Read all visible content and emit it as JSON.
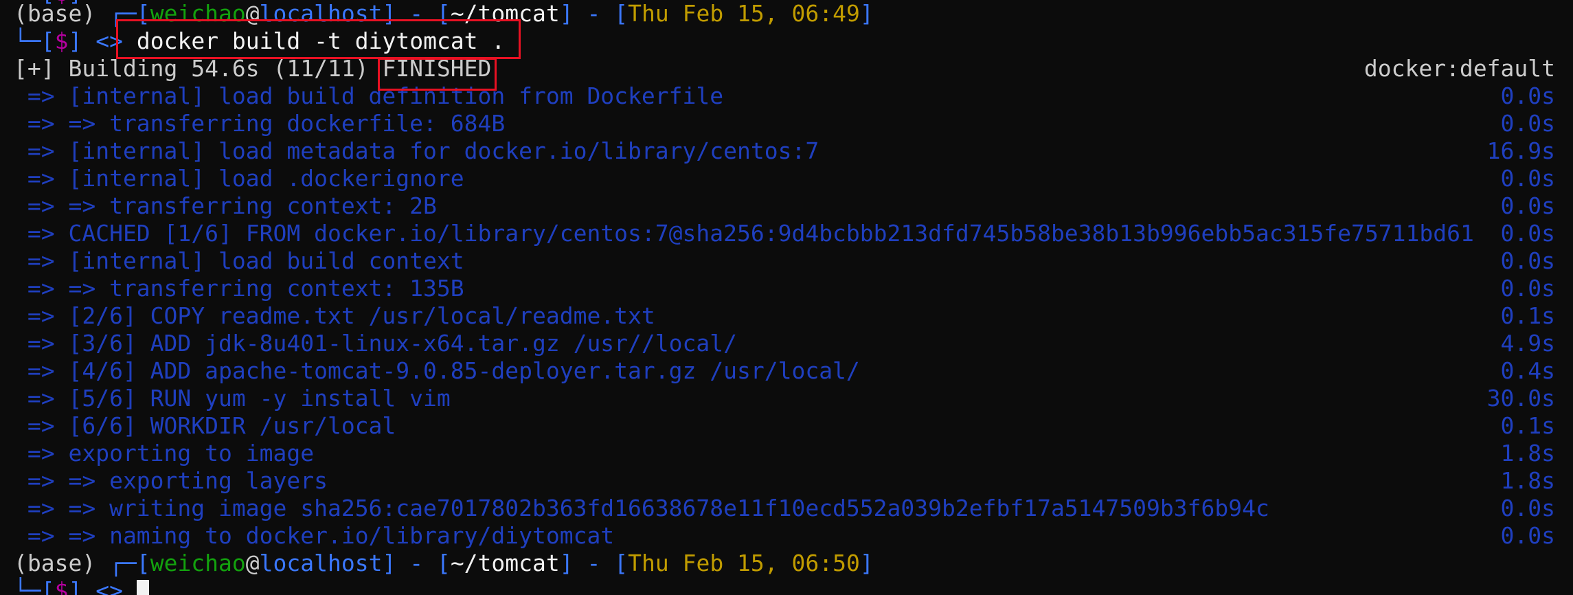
{
  "prompt1": {
    "env": "(base)",
    "corner": "┌─[",
    "user": "weichao",
    "at": "@",
    "host": "localhost",
    "sep1": "] - [",
    "dir": "~/tomcat",
    "sep2": "] - [",
    "time": "Thu Feb 15, 06:49",
    "close": "]",
    "line2_prefix": "└─[",
    "dollar": "$",
    "line2_close": "]",
    "arrow": "<>",
    "command": "docker build -t diytomcat ."
  },
  "build_header": {
    "prefix": "[+] Building 54.6s (11/11) ",
    "status": "FINISHED",
    "context": "docker:default"
  },
  "steps": [
    {
      "text": " => [internal] load build definition from Dockerfile",
      "time": "0.0s"
    },
    {
      "text": " => => transferring dockerfile: 684B",
      "time": "0.0s"
    },
    {
      "text": " => [internal] load metadata for docker.io/library/centos:7",
      "time": "16.9s"
    },
    {
      "text": " => [internal] load .dockerignore",
      "time": "0.0s"
    },
    {
      "text": " => => transferring context: 2B",
      "time": "0.0s"
    },
    {
      "text": " => CACHED [1/6] FROM docker.io/library/centos:7@sha256:9d4bcbbb213dfd745b58be38b13b996ebb5ac315fe75711bd61",
      "time": "0.0s"
    },
    {
      "text": " => [internal] load build context",
      "time": "0.0s"
    },
    {
      "text": " => => transferring context: 135B",
      "time": "0.0s"
    },
    {
      "text": " => [2/6] COPY readme.txt /usr/local/readme.txt",
      "time": "0.1s"
    },
    {
      "text": " => [3/6] ADD jdk-8u401-linux-x64.tar.gz /usr//local/",
      "time": "4.9s"
    },
    {
      "text": " => [4/6] ADD apache-tomcat-9.0.85-deployer.tar.gz /usr/local/",
      "time": "0.4s"
    },
    {
      "text": " => [5/6] RUN yum -y install vim",
      "time": "30.0s"
    },
    {
      "text": " => [6/6] WORKDIR /usr/local",
      "time": "0.1s"
    },
    {
      "text": " => exporting to image",
      "time": "1.8s"
    },
    {
      "text": " => => exporting layers",
      "time": "1.8s"
    },
    {
      "text": " => => writing image sha256:cae7017802b363fd16638678e11f10ecd552a039b2efbf17a5147509b3f6b94c",
      "time": "0.0s"
    },
    {
      "text": " => => naming to docker.io/library/diytomcat",
      "time": "0.0s"
    }
  ],
  "prompt2": {
    "env": "(base)",
    "corner": "┌─[",
    "user": "weichao",
    "at": "@",
    "host": "localhost",
    "sep1": "] - [",
    "dir": "~/tomcat",
    "sep2": "] - [",
    "time": "Thu Feb 15, 06:50",
    "close": "]",
    "line2_prefix": "└─[",
    "dollar": "$",
    "line2_close": "]",
    "arrow": "<>"
  },
  "colors": {
    "background": "#0c0c0c",
    "step_text": "#1f3fbf",
    "highlight_box": "#e81123",
    "user": "#13a10e",
    "host": "#3b78ff",
    "time": "#c19c00",
    "dollar": "#b4009e"
  }
}
